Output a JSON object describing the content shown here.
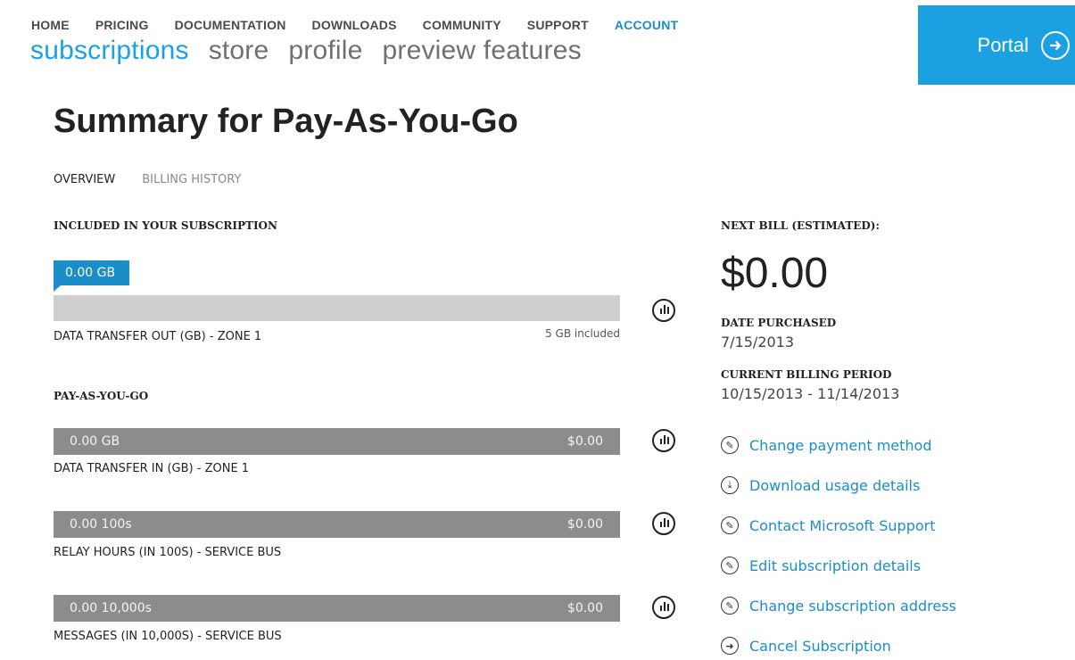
{
  "topnav": [
    "HOME",
    "PRICING",
    "DOCUMENTATION",
    "DOWNLOADS",
    "COMMUNITY",
    "SUPPORT",
    "ACCOUNT"
  ],
  "subnav": [
    "subscriptions",
    "store",
    "profile",
    "preview features"
  ],
  "portal": {
    "label": "Portal",
    "icon": "arrow-right-circle-icon"
  },
  "page": {
    "title": "Summary for Pay-As-You-Go"
  },
  "tabs": [
    "OVERVIEW",
    "BILLING HISTORY"
  ],
  "included": {
    "heading": "INCLUDED IN YOUR SUBSCRIPTION",
    "tooltip": "0.00 GB",
    "label": "DATA TRANSFER OUT (GB) - ZONE 1",
    "allowance": "5 GB included"
  },
  "payg": {
    "heading": "PAY-AS-YOU-GO",
    "meters": [
      {
        "quantity": "0.00 GB",
        "cost": "$0.00",
        "label": "DATA TRANSFER IN (GB) - ZONE 1"
      },
      {
        "quantity": "0.00 100s",
        "cost": "$0.00",
        "label": "RELAY HOURS (IN 100S) - SERVICE BUS"
      },
      {
        "quantity": "0.00 10,000s",
        "cost": "$0.00",
        "label": "MESSAGES (IN 10,000S) - SERVICE BUS"
      }
    ]
  },
  "summary": {
    "next_bill_label": "NEXT BILL (ESTIMATED):",
    "next_bill": "$0.00",
    "date_purchased_label": "DATE PURCHASED",
    "date_purchased": "7/15/2013",
    "billing_period_label": "CURRENT BILLING PERIOD",
    "billing_period": "10/15/2013 - 11/14/2013"
  },
  "actions": [
    {
      "label": "Change payment method",
      "icon": "edit-icon"
    },
    {
      "label": "Download usage details",
      "icon": "download-icon"
    },
    {
      "label": "Contact Microsoft Support",
      "icon": "edit-icon"
    },
    {
      "label": "Edit subscription details",
      "icon": "edit-icon"
    },
    {
      "label": "Change subscription address",
      "icon": "edit-icon"
    },
    {
      "label": "Cancel Subscription",
      "icon": "arrow-right-circle-icon"
    }
  ],
  "colors": {
    "accent": "#1ba1e2",
    "link": "#1b8ec9",
    "bar_light": "#cfcfcf",
    "bar_dark": "#8c8c8c"
  }
}
